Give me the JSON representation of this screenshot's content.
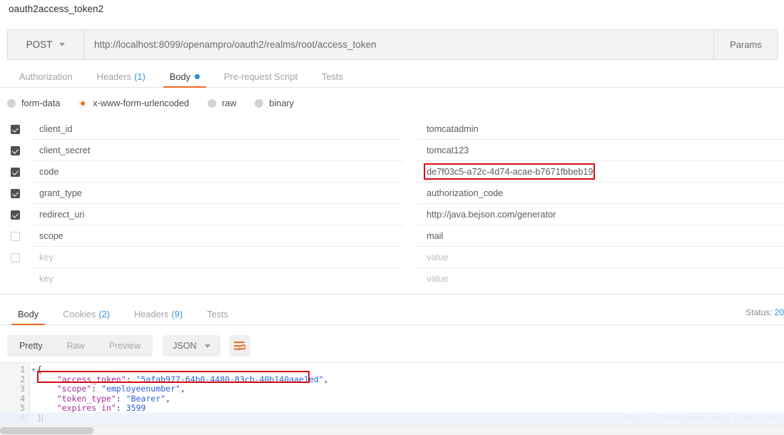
{
  "request": {
    "name": "oauth2access_token2",
    "method": "POST",
    "url": "http://localhost:8099/openampro/oauth2/realms/root/access_token",
    "params_label": "Params",
    "tabs": [
      {
        "label": "Authorization",
        "count": "",
        "active": false,
        "dot": false
      },
      {
        "label": "Headers",
        "count": "(1)",
        "active": false,
        "dot": false
      },
      {
        "label": "Body",
        "count": "",
        "active": true,
        "dot": true
      },
      {
        "label": "Pre-request Script",
        "count": "",
        "active": false,
        "dot": false
      },
      {
        "label": "Tests",
        "count": "",
        "active": false,
        "dot": false
      }
    ],
    "body_types": [
      {
        "label": "form-data",
        "selected": false
      },
      {
        "label": "x-www-form-urlencoded",
        "selected": true
      },
      {
        "label": "raw",
        "selected": false
      },
      {
        "label": "binary",
        "selected": false
      }
    ],
    "params": [
      {
        "checked": true,
        "key": "client_id",
        "key_placeholder": false,
        "value": "tomcatadmin",
        "value_placeholder": false,
        "highlight": false
      },
      {
        "checked": true,
        "key": "client_secret",
        "key_placeholder": false,
        "value": "tomcat123",
        "value_placeholder": false,
        "highlight": false
      },
      {
        "checked": true,
        "key": "code",
        "key_placeholder": false,
        "value": "de7f03c5-a72c-4d74-acae-b7671fbbeb19",
        "value_placeholder": false,
        "highlight": true
      },
      {
        "checked": true,
        "key": "grant_type",
        "key_placeholder": false,
        "value": "authorization_code",
        "value_placeholder": false,
        "highlight": false
      },
      {
        "checked": true,
        "key": "redirect_uri",
        "key_placeholder": false,
        "value": "http://java.bejson.com/generator",
        "value_placeholder": false,
        "highlight": false
      },
      {
        "checked": false,
        "key": "scope",
        "key_placeholder": false,
        "value": "mail",
        "value_placeholder": false,
        "highlight": false
      },
      {
        "checked": false,
        "key": "key",
        "key_placeholder": true,
        "value": "value",
        "value_placeholder": true,
        "highlight": false
      },
      {
        "checked": false,
        "key": "key",
        "key_placeholder": true,
        "value": "value",
        "value_placeholder": true,
        "highlight": false
      }
    ]
  },
  "response": {
    "tabs": [
      {
        "label": "Body",
        "count": "",
        "active": true
      },
      {
        "label": "Cookies",
        "count": "(2)",
        "active": false
      },
      {
        "label": "Headers",
        "count": "(9)",
        "active": false
      },
      {
        "label": "Tests",
        "count": "",
        "active": false
      }
    ],
    "status_label": "Status:",
    "status_code": "20",
    "view_modes": [
      {
        "label": "Pretty",
        "active": true
      },
      {
        "label": "Raw",
        "active": false
      },
      {
        "label": "Preview",
        "active": false
      }
    ],
    "format": "JSON",
    "wrap_icon": "word-wrap-icon",
    "body_lines": [
      {
        "n": "1",
        "fold": true,
        "text": "{"
      },
      {
        "n": "2",
        "fold": false,
        "text": "    \"access_token\": \"5afab977-64b0-4480-83cb-40b140aae1ed\","
      },
      {
        "n": "3",
        "fold": false,
        "text": "    \"scope\": \"employeenumber\","
      },
      {
        "n": "4",
        "fold": false,
        "text": "    \"token_type\": \"Bearer\","
      },
      {
        "n": "5",
        "fold": false,
        "text": "    \"expires_in\": 3599"
      },
      {
        "n": "6",
        "fold": false,
        "text": "}"
      }
    ]
  },
  "watermark": {
    "text": "https://zhengkai.blog.csdn.net"
  },
  "colors": {
    "accent": "#f26b21",
    "link": "#1f8ce8",
    "highlight_box": "#d60b12"
  }
}
